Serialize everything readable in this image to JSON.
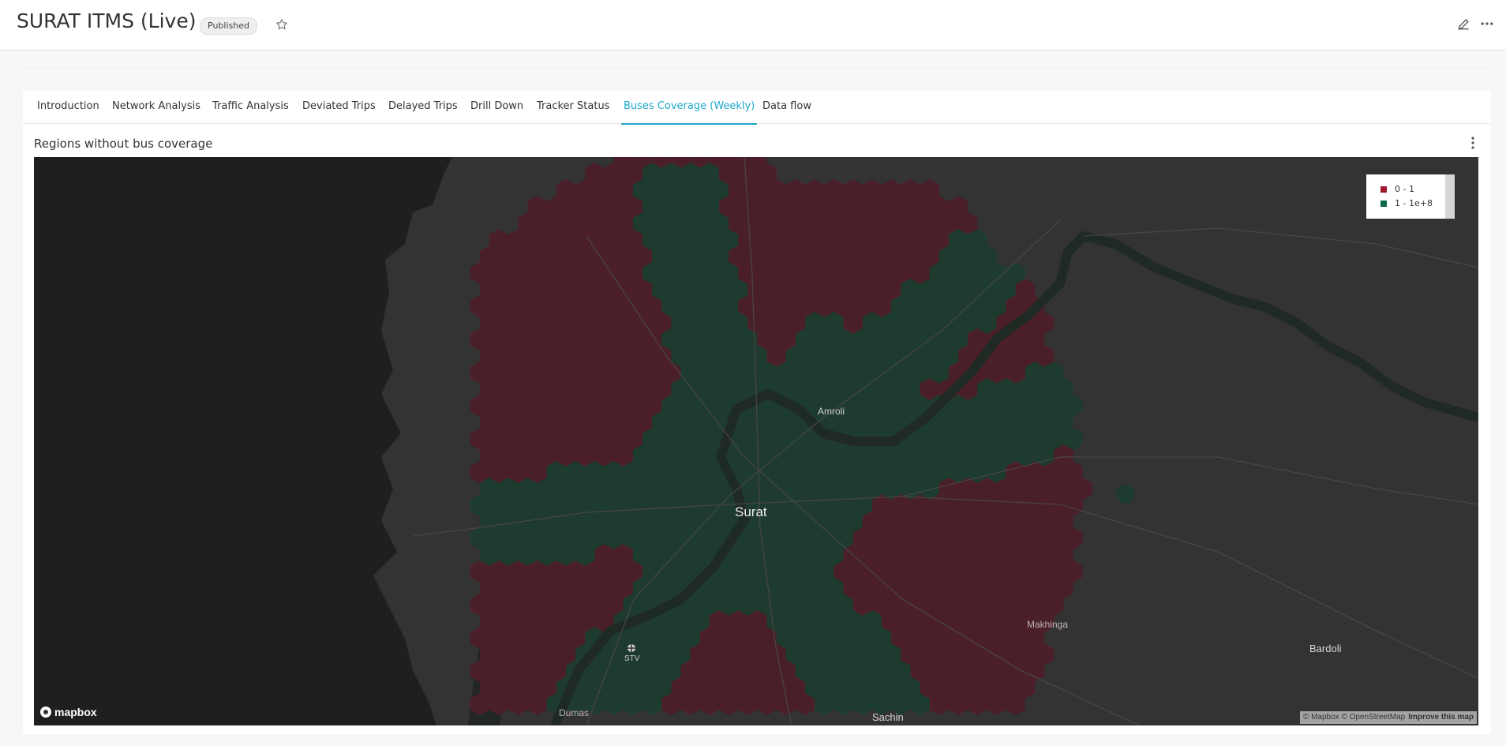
{
  "header": {
    "title": "SURAT ITMS (Live)",
    "status_badge": "Published",
    "icons": [
      "star-icon",
      "edit-icon",
      "more-horizontal-icon"
    ]
  },
  "tabs": [
    {
      "label": "Introduction",
      "active": false
    },
    {
      "label": "Network Analysis",
      "active": false
    },
    {
      "label": "Traffic Analysis",
      "active": false
    },
    {
      "label": "Deviated Trips",
      "active": false
    },
    {
      "label": "Delayed Trips",
      "active": false
    },
    {
      "label": "Drill Down",
      "active": false
    },
    {
      "label": "Tracker Status",
      "active": false
    },
    {
      "label": "Buses Coverage (Weekly)",
      "active": true
    },
    {
      "label": "Data flow",
      "active": false
    }
  ],
  "chart": {
    "title": "Regions without bus coverage",
    "menu_icon": "more-vertical-icon"
  },
  "map": {
    "legend": [
      {
        "label": "0 - 1",
        "color": "#a0182e"
      },
      {
        "label": "1 - 1e+8",
        "color": "#0d6b45"
      }
    ],
    "places": {
      "amroli": "Amroli",
      "surat": "Surat",
      "makhinga": "Makhinga",
      "bardoli": "Bardoli",
      "stv": "STV",
      "dumas": "Dumas",
      "sachin": "Sachin"
    },
    "logo": "mapbox",
    "attribution": {
      "credits": "© Mapbox © OpenStreetMap",
      "improve_link": "Improve this map"
    },
    "colors": {
      "sea": "#1e2020",
      "land": "#343333",
      "uncovered_hex": "#4b1f29",
      "covered_hex": "#1e3b30",
      "river": "#1f2a25"
    }
  }
}
